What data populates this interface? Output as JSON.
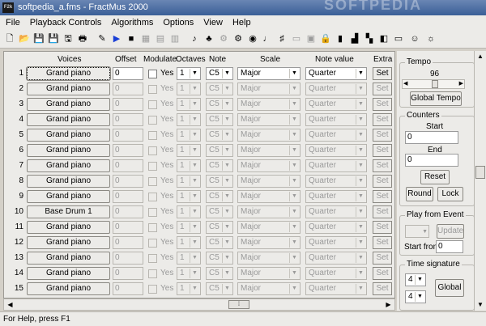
{
  "window": {
    "title": "softpedia_a.fms - FractMus 2000",
    "icon_text": "F2k",
    "watermark": "SOFTPEDIA"
  },
  "menu": [
    "File",
    "Playback Controls",
    "Algorithms",
    "Options",
    "View",
    "Help"
  ],
  "toolbar_icons": [
    {
      "name": "new-file-icon",
      "glyph": "🗋"
    },
    {
      "name": "open-folder-icon",
      "glyph": "📂"
    },
    {
      "name": "save-icon",
      "glyph": "💾"
    },
    {
      "name": "save-as-icon",
      "glyph": "💾"
    },
    {
      "name": "export-icon",
      "glyph": "🖫"
    },
    {
      "name": "print-icon",
      "glyph": "🖶"
    },
    {
      "name": "compose-icon",
      "glyph": "✎"
    },
    {
      "name": "play-icon",
      "glyph": "▶"
    },
    {
      "name": "stop-icon",
      "glyph": "■"
    },
    {
      "name": "grid-view-icon",
      "glyph": "▦"
    },
    {
      "name": "list-view-icon",
      "glyph": "▤"
    },
    {
      "name": "table-view-icon",
      "glyph": "▥"
    },
    {
      "name": "music-note-icon",
      "glyph": "♪"
    },
    {
      "name": "algorithm-icon",
      "glyph": "♣"
    },
    {
      "name": "network-icon",
      "glyph": "⚙"
    },
    {
      "name": "gears-icon",
      "glyph": "⚙"
    },
    {
      "name": "globe-icon",
      "glyph": "◉"
    },
    {
      "name": "quarter-note-icon",
      "glyph": "♩"
    },
    {
      "name": "sharp-icon",
      "glyph": "♯"
    },
    {
      "name": "window-icon",
      "glyph": "▭"
    },
    {
      "name": "score-icon",
      "glyph": "▣"
    },
    {
      "name": "lock-icon",
      "glyph": "🔒"
    },
    {
      "name": "bars-icon",
      "glyph": "▮"
    },
    {
      "name": "chart-icon",
      "glyph": "▟"
    },
    {
      "name": "instrument-icon",
      "glyph": "▚"
    },
    {
      "name": "speaker-icon",
      "glyph": "◧"
    },
    {
      "name": "monitor-icon",
      "glyph": "▭"
    },
    {
      "name": "smiley-icon",
      "glyph": "☺"
    },
    {
      "name": "lightbulb-icon",
      "glyph": "☼"
    }
  ],
  "columns": {
    "voices": "Voices",
    "offset": "Offset",
    "modulate": "Modulate",
    "octaves": "Octaves",
    "note": "Note",
    "scale": "Scale",
    "note_value": "Note value",
    "extra": "Extra"
  },
  "rows": [
    {
      "num": "1",
      "voice": "Grand piano",
      "offset": "0",
      "modulate": "Yes",
      "octave": "1",
      "note": "C5",
      "scale": "Major",
      "note_value": "Quarter",
      "extra": "Set",
      "enabled": true
    },
    {
      "num": "2",
      "voice": "Grand piano",
      "offset": "0",
      "modulate": "Yes",
      "octave": "1",
      "note": "C5",
      "scale": "Major",
      "note_value": "Quarter",
      "extra": "Set",
      "enabled": false
    },
    {
      "num": "3",
      "voice": "Grand piano",
      "offset": "0",
      "modulate": "Yes",
      "octave": "1",
      "note": "C5",
      "scale": "Major",
      "note_value": "Quarter",
      "extra": "Set",
      "enabled": false
    },
    {
      "num": "4",
      "voice": "Grand piano",
      "offset": "0",
      "modulate": "Yes",
      "octave": "1",
      "note": "C5",
      "scale": "Major",
      "note_value": "Quarter",
      "extra": "Set",
      "enabled": false
    },
    {
      "num": "5",
      "voice": "Grand piano",
      "offset": "0",
      "modulate": "Yes",
      "octave": "1",
      "note": "C5",
      "scale": "Major",
      "note_value": "Quarter",
      "extra": "Set",
      "enabled": false
    },
    {
      "num": "6",
      "voice": "Grand piano",
      "offset": "0",
      "modulate": "Yes",
      "octave": "1",
      "note": "C5",
      "scale": "Major",
      "note_value": "Quarter",
      "extra": "Set",
      "enabled": false
    },
    {
      "num": "7",
      "voice": "Grand piano",
      "offset": "0",
      "modulate": "Yes",
      "octave": "1",
      "note": "C5",
      "scale": "Major",
      "note_value": "Quarter",
      "extra": "Set",
      "enabled": false
    },
    {
      "num": "8",
      "voice": "Grand piano",
      "offset": "0",
      "modulate": "Yes",
      "octave": "1",
      "note": "C5",
      "scale": "Major",
      "note_value": "Quarter",
      "extra": "Set",
      "enabled": false
    },
    {
      "num": "9",
      "voice": "Grand piano",
      "offset": "0",
      "modulate": "Yes",
      "octave": "1",
      "note": "C5",
      "scale": "Major",
      "note_value": "Quarter",
      "extra": "Set",
      "enabled": false
    },
    {
      "num": "10",
      "voice": "Base Drum 1",
      "offset": "0",
      "modulate": "Yes",
      "octave": "1",
      "note": "C5",
      "scale": "Major",
      "note_value": "Quarter",
      "extra": "Set",
      "enabled": false
    },
    {
      "num": "11",
      "voice": "Grand piano",
      "offset": "0",
      "modulate": "Yes",
      "octave": "1",
      "note": "C5",
      "scale": "Major",
      "note_value": "Quarter",
      "extra": "Set",
      "enabled": false
    },
    {
      "num": "12",
      "voice": "Grand piano",
      "offset": "0",
      "modulate": "Yes",
      "octave": "1",
      "note": "C5",
      "scale": "Major",
      "note_value": "Quarter",
      "extra": "Set",
      "enabled": false
    },
    {
      "num": "13",
      "voice": "Grand piano",
      "offset": "0",
      "modulate": "Yes",
      "octave": "1",
      "note": "C5",
      "scale": "Major",
      "note_value": "Quarter",
      "extra": "Set",
      "enabled": false
    },
    {
      "num": "14",
      "voice": "Grand piano",
      "offset": "0",
      "modulate": "Yes",
      "octave": "1",
      "note": "C5",
      "scale": "Major",
      "note_value": "Quarter",
      "extra": "Set",
      "enabled": false
    },
    {
      "num": "15",
      "voice": "Grand piano",
      "offset": "0",
      "modulate": "Yes",
      "octave": "1",
      "note": "C5",
      "scale": "Major",
      "note_value": "Quarter",
      "extra": "Set",
      "enabled": false
    }
  ],
  "tempo": {
    "title": "Tempo",
    "value": "96",
    "slider_position": 0.55,
    "button": "Global Tempo"
  },
  "counters": {
    "title": "Counters",
    "start_label": "Start",
    "start_value": "0",
    "end_label": "End",
    "end_value": "0",
    "reset": "Reset",
    "round": "Round",
    "lock": "Lock"
  },
  "play_from_event": {
    "title": "Play from Event",
    "select_value": "",
    "update": "Update",
    "start_from_label": "Start from",
    "start_from_value": "0"
  },
  "time_signature": {
    "title": "Time signature",
    "numerator": "4",
    "denominator": "4",
    "button": "Global"
  },
  "status": "For Help, press F1",
  "colors": {
    "titlebar": "#3a5f97",
    "play_icon": "#1a3fd6",
    "window_bg": "#ecebe8"
  }
}
